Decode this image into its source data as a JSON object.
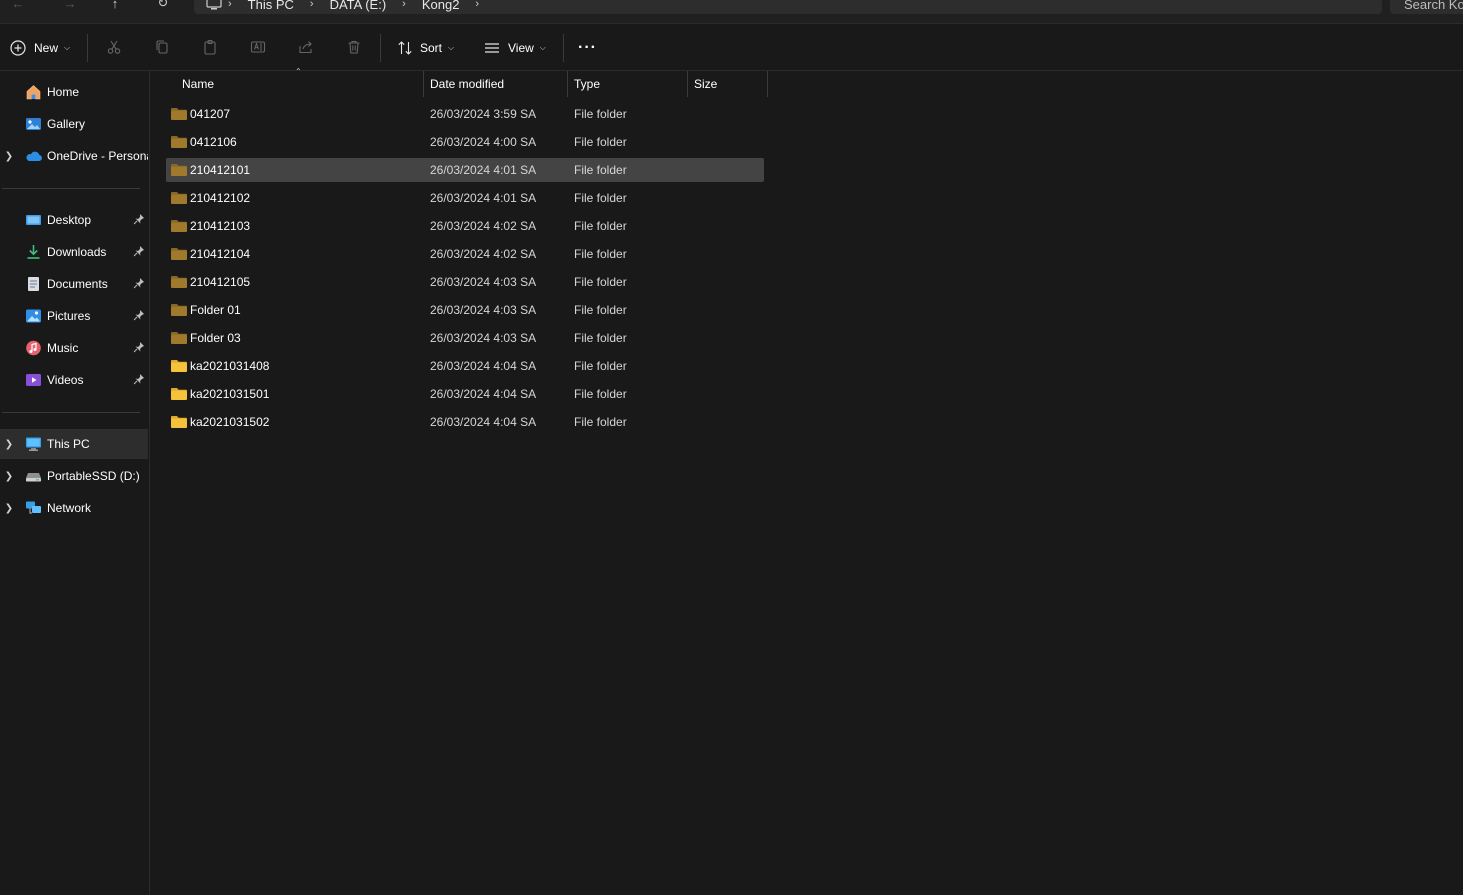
{
  "address_bar": {
    "breadcrumbs": [
      "This PC",
      "DATA (E:)",
      "Kong2"
    ],
    "search_placeholder": "Search Ko"
  },
  "commandbar": {
    "new_label": "New",
    "sort_label": "Sort",
    "view_label": "View",
    "more_label": "···",
    "icons": [
      "cut-icon",
      "copy-icon",
      "paste-icon",
      "rename-icon",
      "share-icon",
      "delete-icon"
    ]
  },
  "sidebar": {
    "top_items": [
      {
        "label": "Home",
        "icon": "home-icon"
      },
      {
        "label": "Gallery",
        "icon": "gallery-icon"
      },
      {
        "label": "OneDrive - Personal",
        "icon": "onedrive-icon"
      }
    ],
    "pinned_items": [
      {
        "label": "Desktop",
        "icon": "desktop-icon"
      },
      {
        "label": "Downloads",
        "icon": "downloads-icon"
      },
      {
        "label": "Documents",
        "icon": "documents-icon"
      },
      {
        "label": "Pictures",
        "icon": "pictures-icon"
      },
      {
        "label": "Music",
        "icon": "music-icon"
      },
      {
        "label": "Videos",
        "icon": "videos-icon"
      }
    ],
    "devices": [
      {
        "label": "This PC",
        "icon": "this-pc-icon",
        "selected": true
      },
      {
        "label": "PortableSSD (D:)",
        "icon": "drive-icon"
      },
      {
        "label": "Network",
        "icon": "network-icon"
      }
    ]
  },
  "file_list": {
    "columns": [
      "Name",
      "Date modified",
      "Type",
      "Size"
    ],
    "rows": [
      {
        "name": "041207",
        "date": "26/03/2024 3:59 SA",
        "type": "File folder",
        "size": "",
        "style": "dark"
      },
      {
        "name": "0412106",
        "date": "26/03/2024 4:00 SA",
        "type": "File folder",
        "size": "",
        "style": "dark"
      },
      {
        "name": "210412101",
        "date": "26/03/2024 4:01 SA",
        "type": "File folder",
        "size": "",
        "style": "dark",
        "selected": true
      },
      {
        "name": "210412102",
        "date": "26/03/2024 4:01 SA",
        "type": "File folder",
        "size": "",
        "style": "dark"
      },
      {
        "name": "210412103",
        "date": "26/03/2024 4:02 SA",
        "type": "File folder",
        "size": "",
        "style": "dark"
      },
      {
        "name": "210412104",
        "date": "26/03/2024 4:02 SA",
        "type": "File folder",
        "size": "",
        "style": "dark"
      },
      {
        "name": "210412105",
        "date": "26/03/2024 4:03 SA",
        "type": "File folder",
        "size": "",
        "style": "dark"
      },
      {
        "name": "Folder 01",
        "date": "26/03/2024 4:03 SA",
        "type": "File folder",
        "size": "",
        "style": "dark"
      },
      {
        "name": "Folder 03",
        "date": "26/03/2024 4:03 SA",
        "type": "File folder",
        "size": "",
        "style": "dark"
      },
      {
        "name": "ka2021031408",
        "date": "26/03/2024 4:04 SA",
        "type": "File folder",
        "size": "",
        "style": "bright"
      },
      {
        "name": "ka2021031501",
        "date": "26/03/2024 4:04 SA",
        "type": "File folder",
        "size": "",
        "style": "bright"
      },
      {
        "name": "ka2021031502",
        "date": "26/03/2024 4:04 SA",
        "type": "File folder",
        "size": "",
        "style": "bright"
      }
    ]
  },
  "colors": {
    "background": "#191919",
    "selected_row": "#444444",
    "folder_dark": "#a07a2c",
    "folder_bright": "#f5c33b",
    "accent": "#4cc2ff"
  }
}
